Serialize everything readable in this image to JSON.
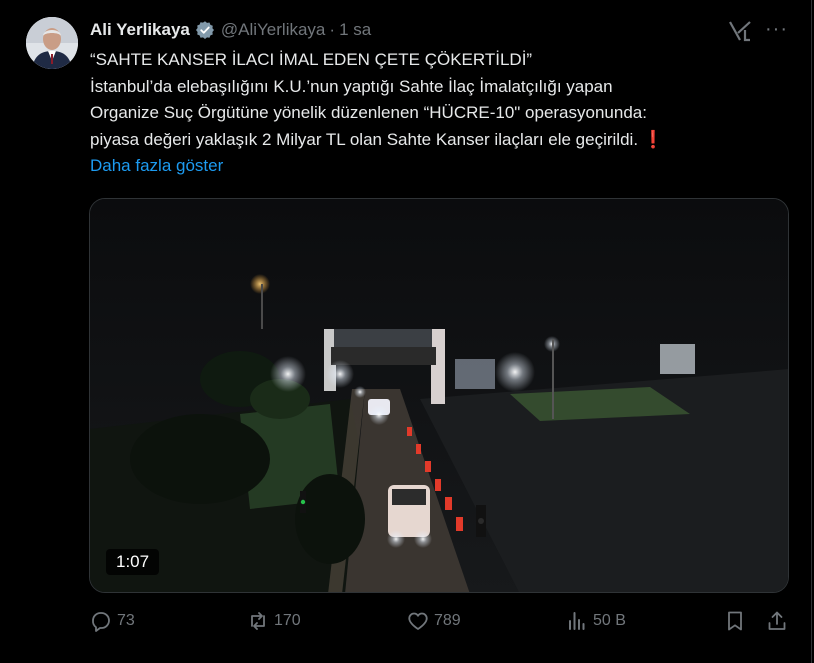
{
  "post": {
    "author_name": "Ali Yerlikaya",
    "handle": "@AliYerlikaya",
    "separator": "·",
    "time": "1 sa",
    "more_label": "···",
    "lines": [
      "“SAHTE KANSER İLACI İMAL EDEN ÇETE ÇÖKERTİLDİ”",
      "İstanbul’da elebaşılığını K.U.’nun yaptığı Sahte İlaç İmalatçılığı yapan",
      "Organize Suç Örgütüne yönelik düzenlenen “HÜCRE-10\" operasyonunda:",
      "piyasa değeri yaklaşık 2 Milyar TL olan Sahte Kanser ilaçları ele geçirildi."
    ],
    "emoji": "❗",
    "show_more": "Daha fazla göster",
    "video_duration": "1:07"
  },
  "actions": {
    "replies": "73",
    "reposts": "170",
    "likes": "789",
    "views": "50 B"
  },
  "colors": {
    "background": "#000000",
    "text": "#e7e9ea",
    "muted": "#71767b",
    "link": "#1d9bf0",
    "verified": "#829aab"
  }
}
